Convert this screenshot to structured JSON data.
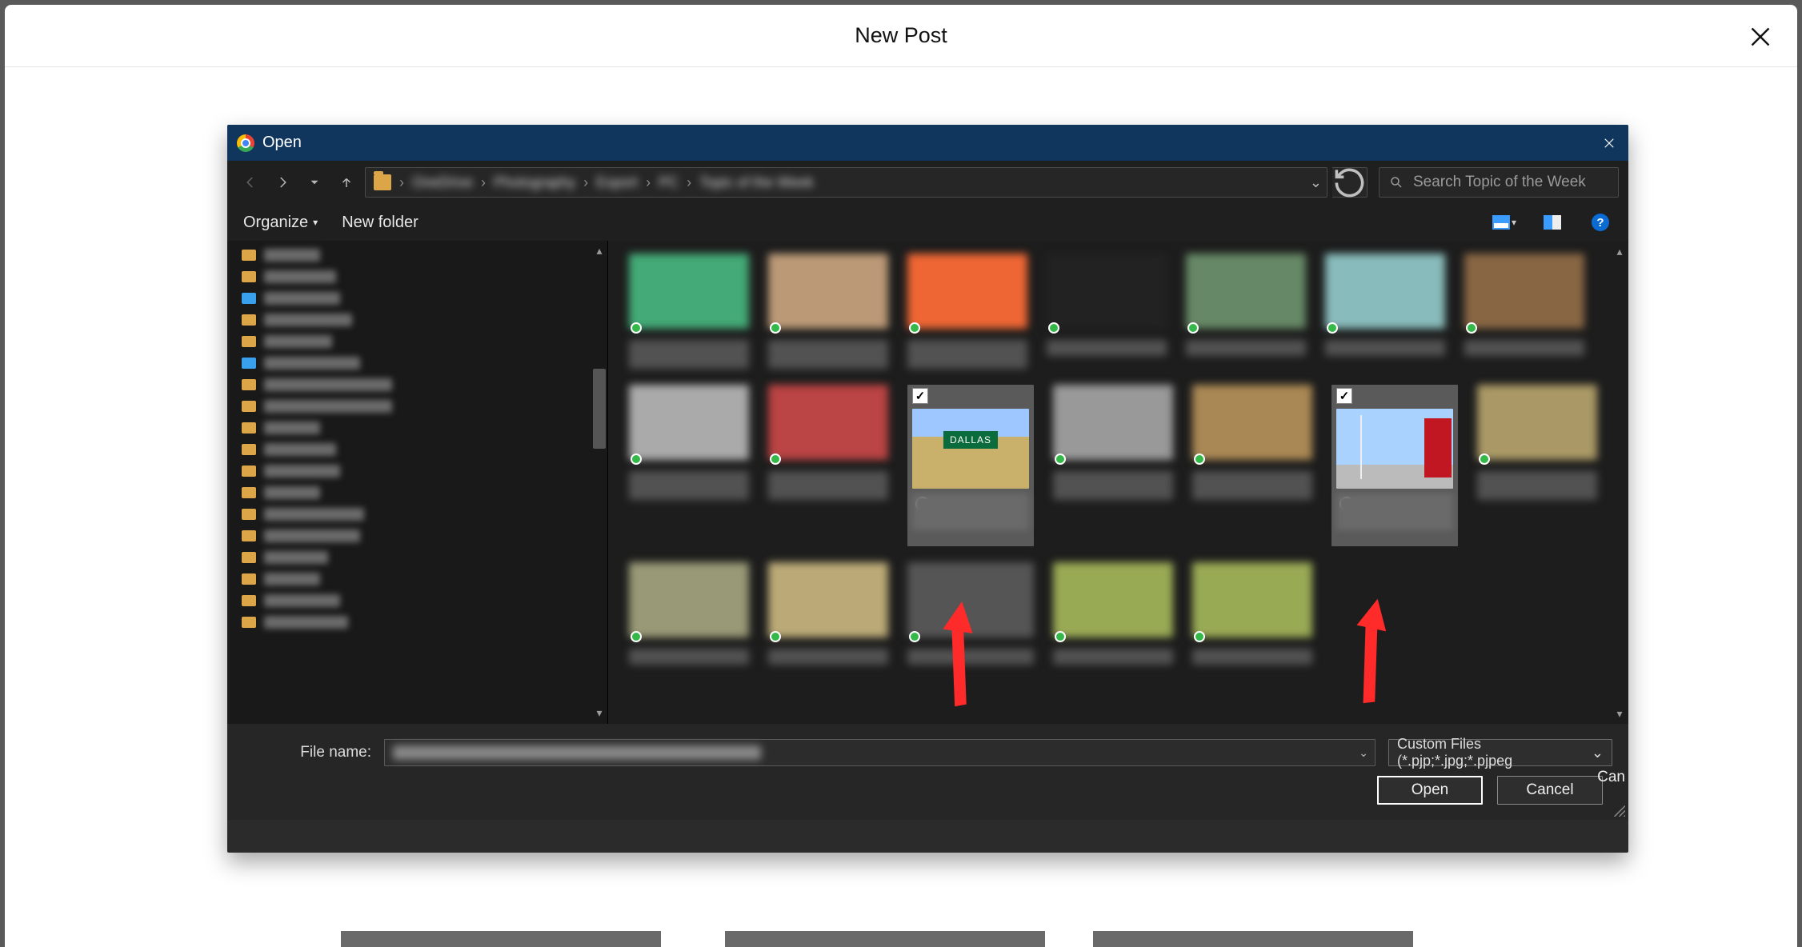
{
  "outer": {
    "title": "New Post"
  },
  "dialog": {
    "title": "Open",
    "nav": {
      "breadcrumb_parts": [
        "OneDrive",
        "Photography",
        "Export",
        "PC",
        "Topic of the Week"
      ],
      "search_placeholder": "Search Topic of the Week"
    },
    "toolbar": {
      "organize_label": "Organize",
      "new_folder_label": "New folder"
    },
    "footer": {
      "file_name_label": "File name:",
      "file_type_label": "Custom Files (*.pjp;*.jpg;*.pjpeg",
      "open_label": "Open",
      "cancel_label": "Cancel",
      "cutoff_label": "Can"
    },
    "selected_count": 2
  }
}
